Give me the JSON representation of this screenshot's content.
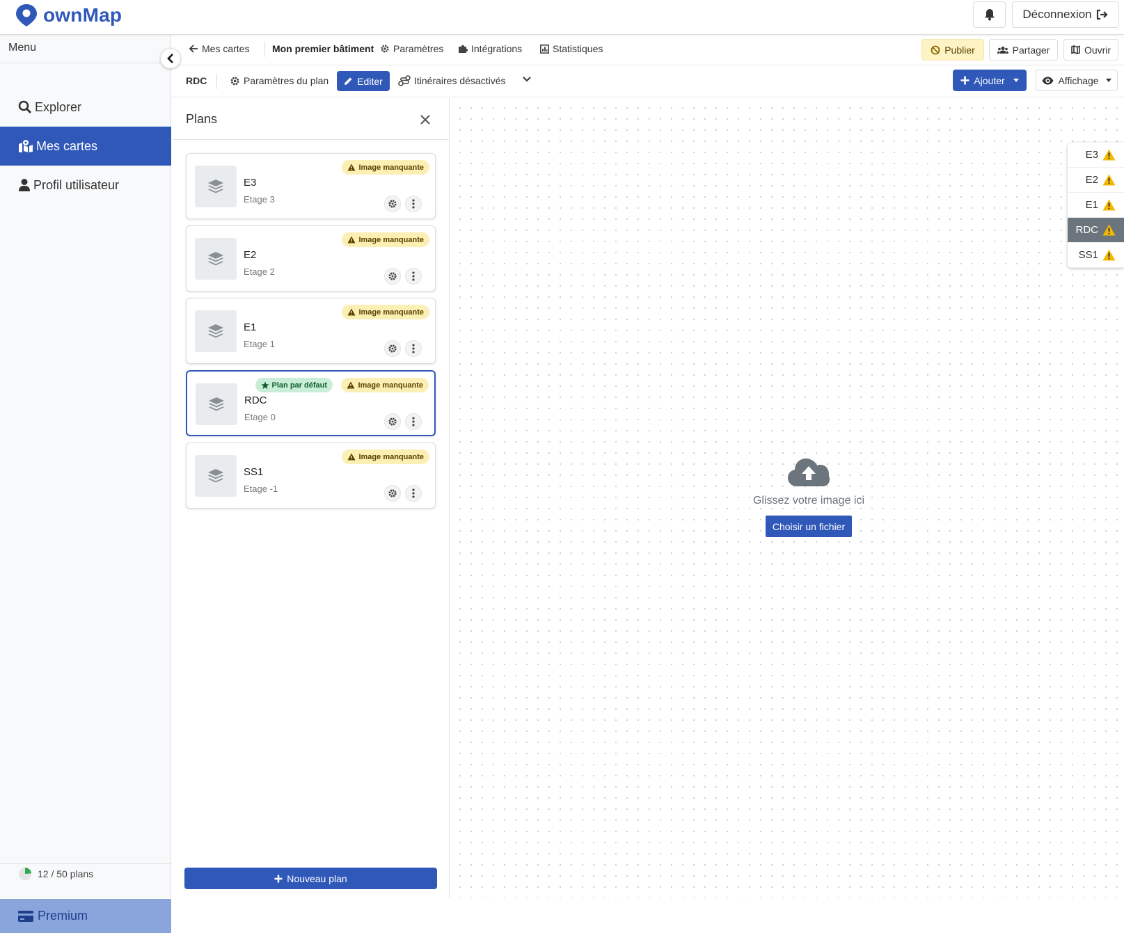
{
  "app": {
    "name": "ownMap"
  },
  "topbar": {
    "logout_label": "Déconnexion"
  },
  "sidebar": {
    "menu_label": "Menu",
    "items": [
      {
        "label": "Explorer",
        "icon": "search-icon"
      },
      {
        "label": "Mes cartes",
        "icon": "map-icon",
        "active": true
      },
      {
        "label": "Profil utilisateur",
        "icon": "user-icon"
      }
    ],
    "plans_usage": "12 / 50 plans",
    "plans_usage_fraction": 0.24,
    "premium_label": "Premium"
  },
  "toolbar": {
    "back_label": "Mes cartes",
    "map_title": "Mon premier bâtiment",
    "settings_label": "Paramètres",
    "integrations_label": "Intégrations",
    "stats_label": "Statistiques",
    "publish_label": "Publier",
    "share_label": "Partager",
    "open_label": "Ouvrir"
  },
  "subtoolbar": {
    "current_plan": "RDC",
    "plan_settings_label": "Paramètres du plan",
    "edit_label": "Editer",
    "routes_label": "Itinéraires désactivés",
    "add_label": "Ajouter",
    "display_label": "Affichage"
  },
  "plans_panel": {
    "title": "Plans",
    "new_plan_label": "Nouveau plan",
    "missing_image_label": "Image manquante",
    "default_plan_label": "Plan par défaut",
    "plans": [
      {
        "name": "E3",
        "floor": "Etage 3",
        "default": false
      },
      {
        "name": "E2",
        "floor": "Etage 2",
        "default": false
      },
      {
        "name": "E1",
        "floor": "Etage 1",
        "default": false
      },
      {
        "name": "RDC",
        "floor": "Etage 0",
        "default": true
      },
      {
        "name": "SS1",
        "floor": "Etage -1",
        "default": false
      }
    ]
  },
  "canvas": {
    "drop_text": "Glissez votre image ici",
    "choose_file_label": "Choisir un fichier"
  },
  "level_switcher": {
    "levels": [
      "E3",
      "E2",
      "E1",
      "RDC",
      "SS1"
    ],
    "active": "RDC"
  },
  "colors": {
    "primary": "#2f58b8",
    "warning": "#f5b800",
    "warning_badge_bg": "#fcefb4",
    "success_badge_bg": "#c9eed7"
  }
}
